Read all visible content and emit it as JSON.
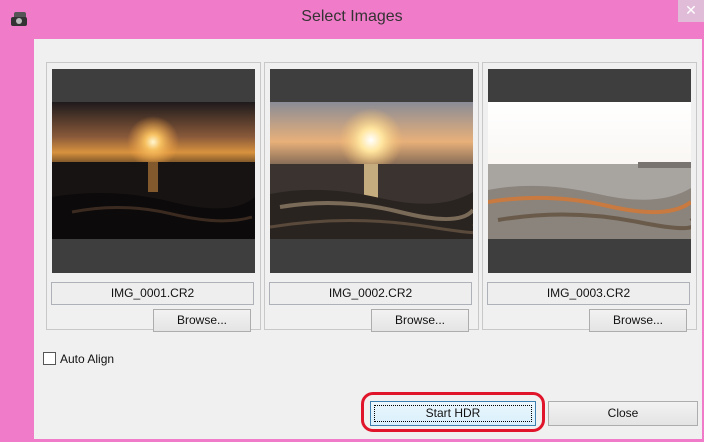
{
  "window": {
    "title": "Select Images",
    "close_glyph": "✕",
    "app_icon": "hdr-app-icon"
  },
  "images": [
    {
      "filename": "IMG_0001.CR2",
      "browse_label": "Browse...",
      "exposure": "dark"
    },
    {
      "filename": "IMG_0002.CR2",
      "browse_label": "Browse...",
      "exposure": "normal"
    },
    {
      "filename": "IMG_0003.CR2",
      "browse_label": "Browse...",
      "exposure": "bright"
    }
  ],
  "options": {
    "auto_align_label": "Auto Align",
    "auto_align_checked": false
  },
  "actions": {
    "start_label": "Start HDR",
    "close_label": "Close"
  },
  "colors": {
    "titlebar": "#f07bc8",
    "highlight": "#e0142a"
  }
}
